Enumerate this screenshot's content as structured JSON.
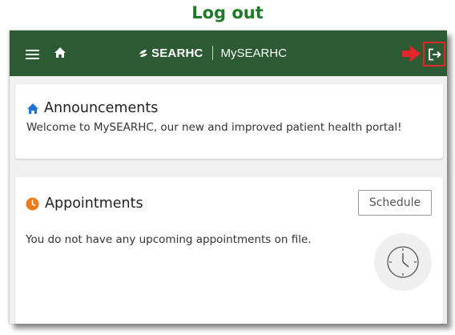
{
  "annotation": {
    "title": "Log out"
  },
  "header": {
    "brand_name": "SEARHC",
    "app_name": "MySEARHC",
    "icons": {
      "menu": "hamburger-menu-icon",
      "home": "home-icon",
      "logout": "logout-icon",
      "pointer": "red-arrow-icon"
    }
  },
  "announcements": {
    "title": "Announcements",
    "message": "Welcome to MySEARHC, our new and improved patient health portal!",
    "icon": "home-icon"
  },
  "appointments": {
    "title": "Appointments",
    "schedule_label": "Schedule",
    "message": "You do not have any upcoming appointments on file.",
    "icon": "clock-icon"
  },
  "colors": {
    "header_bg": "#2b5a33",
    "annotation_green": "#1f7a27",
    "highlight_red": "#e3262a",
    "home_blue": "#1e73d8",
    "appointments_orange": "#ee7a1a",
    "page_bg": "#f1f1f1"
  }
}
